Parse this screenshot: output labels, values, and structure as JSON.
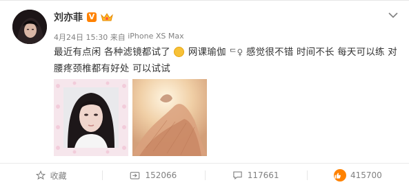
{
  "post": {
    "author": "刘亦菲",
    "verified_mark": "V",
    "timestamp": "4月24日 15:30",
    "source_prefix": "来自",
    "source": "iPhone XS Max",
    "content": {
      "part1": "最近有点闲 各种滤镜都试了",
      "part2": " 网课瑜伽",
      "part3": "感觉很不错 时间不长 每天可以练 对腰疼颈椎都有好处 可以试试",
      "emoji2_glyph": "ᄃ♀"
    },
    "photo_count": 2
  },
  "actions": {
    "favorite_label": "收藏",
    "reposts": "152066",
    "comments": "117661",
    "likes": "415700"
  },
  "colors": {
    "brand_orange": "#ff8200",
    "text": "#333333",
    "meta": "#808080"
  },
  "icons": {
    "chevron": "chevron-down-icon",
    "favorite": "star-icon",
    "repost": "repost-icon",
    "comment": "comment-icon",
    "like": "thumbs-up-icon"
  }
}
